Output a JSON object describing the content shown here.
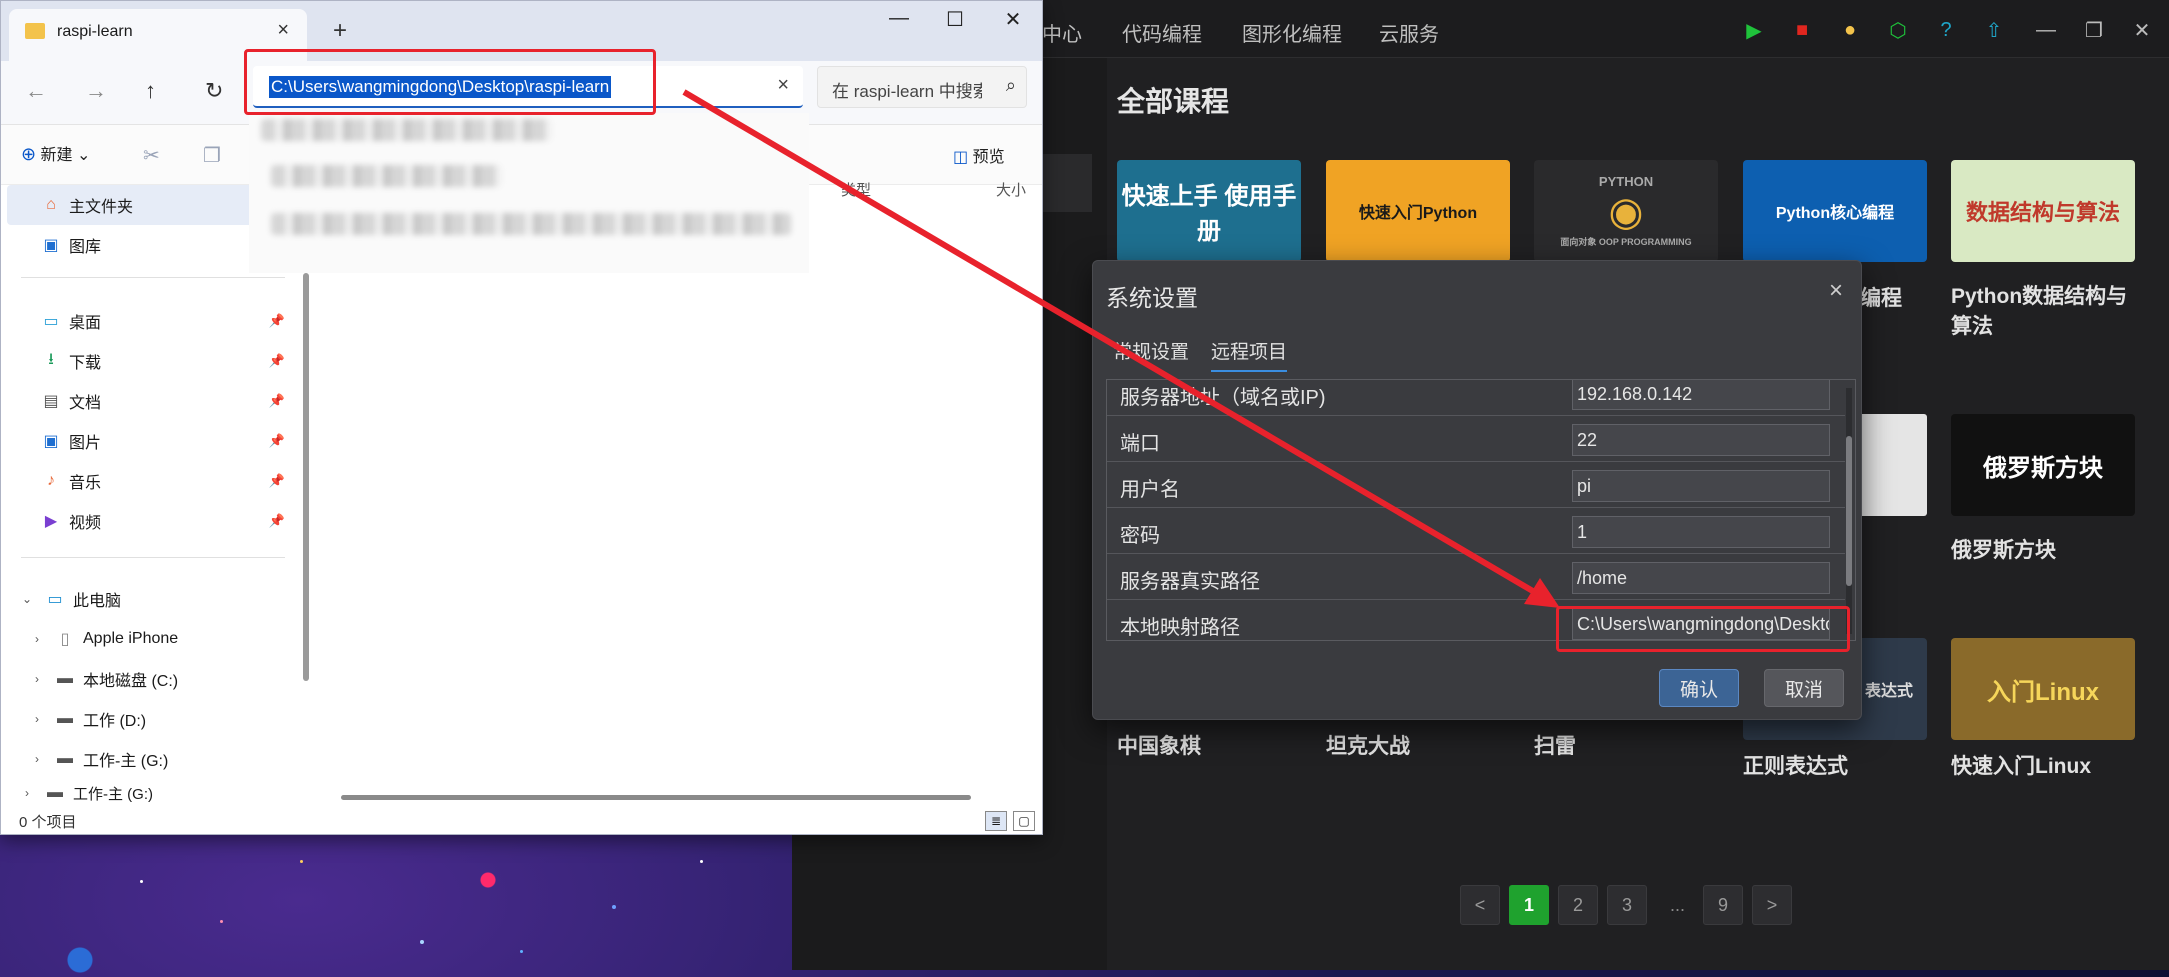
{
  "app": {
    "nav": [
      "中心",
      "代码编程",
      "图形化编程",
      "云服务"
    ],
    "section_title": "全部课程",
    "courses": [
      {
        "thumb": "快速上手 使用手册",
        "name": ""
      },
      {
        "thumb": "快速入门Python",
        "name": ""
      },
      {
        "thumb": "PYTHON",
        "thumb_sub": "面向对象 OOP PROGRAMMING",
        "name": ""
      },
      {
        "thumb": "Python核心编程",
        "name": "编程"
      },
      {
        "thumb": "数据结构与算法",
        "name": "Python数据结构与算法"
      },
      {
        "thumb": "俄罗斯方块",
        "name": "俄罗斯方块"
      },
      {
        "thumb": "",
        "name": "中国象棋"
      },
      {
        "thumb": "",
        "name": "坦克大战"
      },
      {
        "thumb": "",
        "name": "扫雷"
      },
      {
        "thumb": "表达式",
        "name": "正则表达式"
      },
      {
        "thumb": "入门Linux",
        "name": "快速入门Linux"
      }
    ],
    "pager": {
      "prev": "<",
      "pages": [
        "1",
        "2",
        "3"
      ],
      "ellipsis": "...",
      "last": "9",
      "next": ">",
      "current": "1"
    }
  },
  "dialog": {
    "title": "系统设置",
    "close": "×",
    "tabs": [
      "常规设置",
      "远程项目"
    ],
    "active_tab": "远程项目",
    "rows": [
      {
        "label": "服务器地址（域名或IP)",
        "value": "192.168.0.142"
      },
      {
        "label": "端口",
        "value": "22"
      },
      {
        "label": "用户名",
        "value": "pi"
      },
      {
        "label": "密码",
        "value": "1"
      },
      {
        "label": "服务器真实路径",
        "value": "/home"
      },
      {
        "label": "本地映射路径",
        "value": "C:\\Users\\wangmingdong\\Desktop\\raspi-learn"
      }
    ],
    "ok": "确认",
    "cancel": "取消"
  },
  "explorer": {
    "tab_title": "raspi-learn",
    "tab_close": "×",
    "new_tab": "+",
    "address": "C:\\Users\\wangmingdong\\Desktop\\raspi-learn",
    "address_clear": "×",
    "search_placeholder": "在 raspi-learn 中搜索",
    "new_label": "新建",
    "preview_label": "预览",
    "col_type": "类型",
    "col_size": "大小",
    "sidebar": {
      "home": "主文件夹",
      "gallery": "图库",
      "desktop": "桌面",
      "downloads": "下载",
      "documents": "文档",
      "pictures": "图片",
      "music": "音乐",
      "videos": "视频",
      "this_pc": "此电脑",
      "iphone": "Apple iPhone",
      "drive_c": "本地磁盘 (C:)",
      "drive_d": "工作 (D:)",
      "drive_g": "工作-主 (G:)",
      "drive_g2": "工作-主 (G:)"
    },
    "status": "0 个项目"
  },
  "colors": {
    "accent": "#1fa22e",
    "annotation": "#e8222c",
    "selection": "#0a57c9"
  }
}
